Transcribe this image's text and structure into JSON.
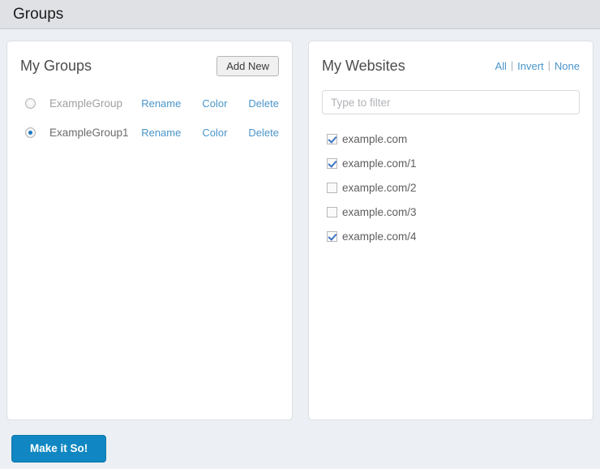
{
  "header": {
    "title": "Groups"
  },
  "groups_panel": {
    "title": "My Groups",
    "add_new_label": "Add New",
    "actions": {
      "rename": "Rename",
      "color": "Color",
      "delete": "Delete"
    },
    "items": [
      {
        "name": "ExampleGroup",
        "selected": false
      },
      {
        "name": "ExampleGroup1",
        "selected": true
      }
    ]
  },
  "websites_panel": {
    "title": "My Websites",
    "select_links": {
      "all": "All",
      "separator": "|",
      "invert": "Invert",
      "none": "None"
    },
    "filter": {
      "placeholder": "Type to filter",
      "value": ""
    },
    "items": [
      {
        "name": "example.com",
        "checked": true
      },
      {
        "name": "example.com/1",
        "checked": true
      },
      {
        "name": "example.com/2",
        "checked": false
      },
      {
        "name": "example.com/3",
        "checked": false
      },
      {
        "name": "example.com/4",
        "checked": true
      }
    ]
  },
  "footer": {
    "submit_label": "Make it So!"
  },
  "colors": {
    "page_background": "#eceff3",
    "header_background": "#dfe1e5",
    "link": "#4a95ca",
    "primary_button": "#1087c2",
    "radio_selected": "#1b78c4",
    "checkbox_check": "#3f74c0"
  }
}
